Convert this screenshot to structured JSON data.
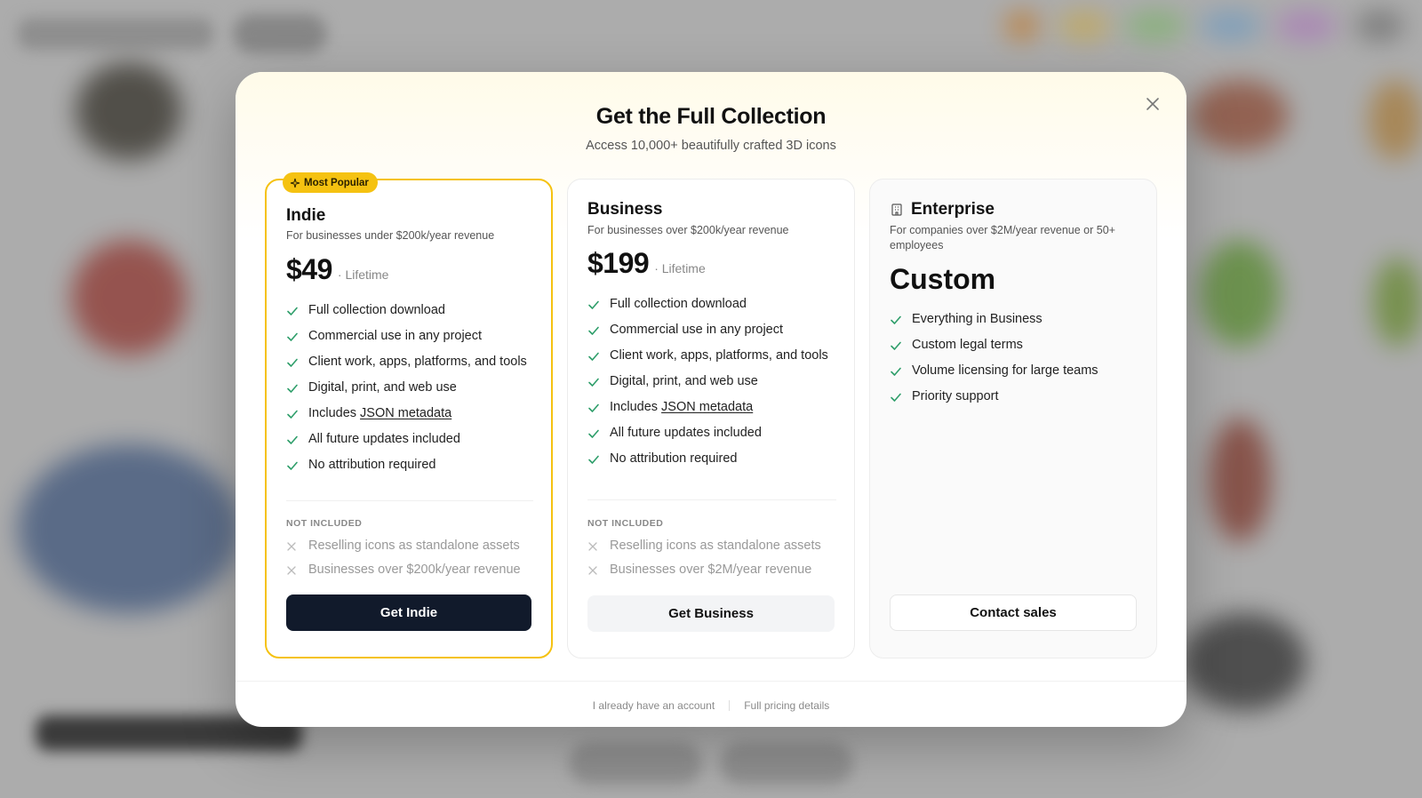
{
  "modal": {
    "title": "Get the Full Collection",
    "subtitle": "Access 10,000+ beautifully crafted 3D icons",
    "close_icon": "close-icon"
  },
  "plans": [
    {
      "badge": "Most Popular",
      "name": "Indie",
      "description": "For businesses under $200k/year revenue",
      "price": "$49",
      "price_suffix": "· Lifetime",
      "features": [
        "Full collection download",
        "Commercial use in any project",
        "Client work, apps, platforms, and tools",
        "Digital, print, and web use",
        {
          "prefix": "Includes ",
          "link": "JSON metadata"
        },
        "All future updates included",
        "No attribution required"
      ],
      "not_included_label": "NOT INCLUDED",
      "not_included": [
        "Reselling icons as standalone assets",
        "Businesses over $200k/year revenue"
      ],
      "cta": "Get Indie"
    },
    {
      "name": "Business",
      "description": "For businesses over $200k/year revenue",
      "price": "$199",
      "price_suffix": "· Lifetime",
      "features": [
        "Full collection download",
        "Commercial use in any project",
        "Client work, apps, platforms, and tools",
        "Digital, print, and web use",
        {
          "prefix": "Includes ",
          "link": "JSON metadata"
        },
        "All future updates included",
        "No attribution required"
      ],
      "not_included_label": "NOT INCLUDED",
      "not_included": [
        "Reselling icons as standalone assets",
        "Businesses over $2M/year revenue"
      ],
      "cta": "Get Business"
    },
    {
      "name": "Enterprise",
      "icon": "building-icon",
      "description": "For companies over $2M/year revenue or 50+ employees",
      "price": "Custom",
      "features": [
        "Everything in Business",
        "Custom legal terms",
        "Volume licensing for large teams",
        "Priority support"
      ],
      "cta": "Contact sales"
    }
  ],
  "footer": {
    "login_link": "I already have an account",
    "pricing_link": "Full pricing details"
  },
  "colors": {
    "accent": "#f5c211",
    "check": "#2e9e6a",
    "primary_button": "#111a2b"
  }
}
